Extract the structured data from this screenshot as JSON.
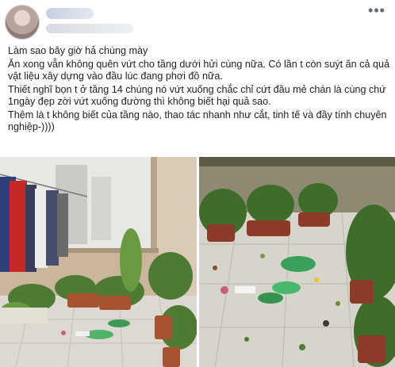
{
  "post": {
    "more_icon": "ellipsis-icon",
    "lines": [
      "Làm sao bây giờ hả chúng mày",
      "Ăn xong vẫn không quên vứt cho tầng dưới hửi cùng nữa. Có lần t còn suýt ăn cả quả vật liệu xây dựng vào đầu lúc đang phơi đồ nữa.",
      "Thiết nghĩ bọn t ở tầng 14 chúng nó vứt xuống chắc chỉ cứt đầu mẻ chán là cùng chứ 1ngày đẹp zời vứt xuống đường thì không biết hại quả sao.",
      "Thêm là t không biết của tầng nào, thao tác nhanh như cắt, tinh tế và đầy tính chuyên nghiệp-))))"
    ]
  },
  "photos": [
    {
      "label": "balcony-with-laundry-and-plants"
    },
    {
      "label": "balcony-floor-with-thrown-trash"
    }
  ],
  "colors": {
    "text": "#1c1e21",
    "meta": "#606770"
  }
}
